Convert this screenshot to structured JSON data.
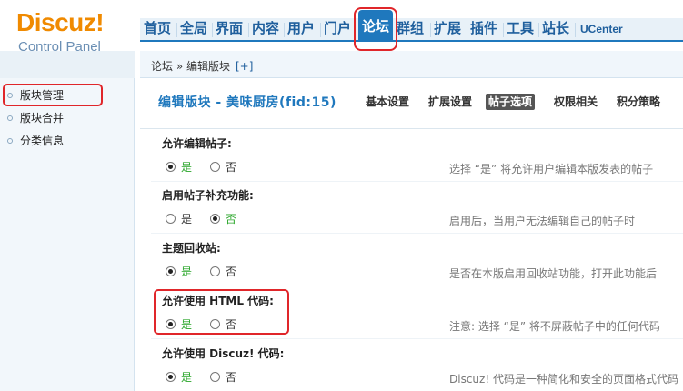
{
  "logo": {
    "main": "Discuz!",
    "sub": "Control Panel"
  },
  "nav": {
    "items": [
      {
        "label": "首页"
      },
      {
        "label": "全局"
      },
      {
        "label": "界面"
      },
      {
        "label": "内容"
      },
      {
        "label": "用户"
      },
      {
        "label": "门户"
      },
      {
        "label": "论坛"
      },
      {
        "label": "群组"
      },
      {
        "label": "扩展"
      },
      {
        "label": "插件"
      },
      {
        "label": "工具"
      },
      {
        "label": "站长"
      },
      {
        "label": "UCenter"
      }
    ],
    "active": "论坛"
  },
  "breadcrumb": {
    "text": "论坛 » 编辑版块",
    "add": "[+]"
  },
  "sidebar": {
    "items": [
      {
        "label": "版块管理"
      },
      {
        "label": "版块合并"
      },
      {
        "label": "分类信息"
      }
    ]
  },
  "main": {
    "title": "编辑版块 - 美味厨房(fid:15)",
    "tabs": [
      {
        "label": "基本设置"
      },
      {
        "label": "扩展设置"
      },
      {
        "label": "帖子选项"
      },
      {
        "label": "权限相关"
      },
      {
        "label": "积分策略"
      }
    ],
    "active_tab": "帖子选项",
    "yes": "是",
    "no": "否",
    "rows": [
      {
        "label": "允许编辑帖子:",
        "value": "yes",
        "desc": "选择 “是” 将允许用户编辑本版发表的帖子"
      },
      {
        "label": "启用帖子补充功能:",
        "value": "no",
        "desc": "启用后，当用户无法编辑自己的帖子时"
      },
      {
        "label": "主题回收站:",
        "value": "yes",
        "desc": "是否在本版启用回收站功能，打开此功能后"
      },
      {
        "label": "允许使用 HTML 代码:",
        "value": "yes",
        "desc": "注意: 选择 “是” 将不屏蔽帖子中的任何代码"
      },
      {
        "label": "允许使用 Discuz! 代码:",
        "value": "yes",
        "desc": "Discuz! 代码是一种简化和安全的页面格式代码"
      }
    ]
  },
  "colors": {
    "accent": "#1f78bd",
    "logo": "#f08a00",
    "highlight": "#e0262a",
    "selected_option": "#2aa62a"
  }
}
